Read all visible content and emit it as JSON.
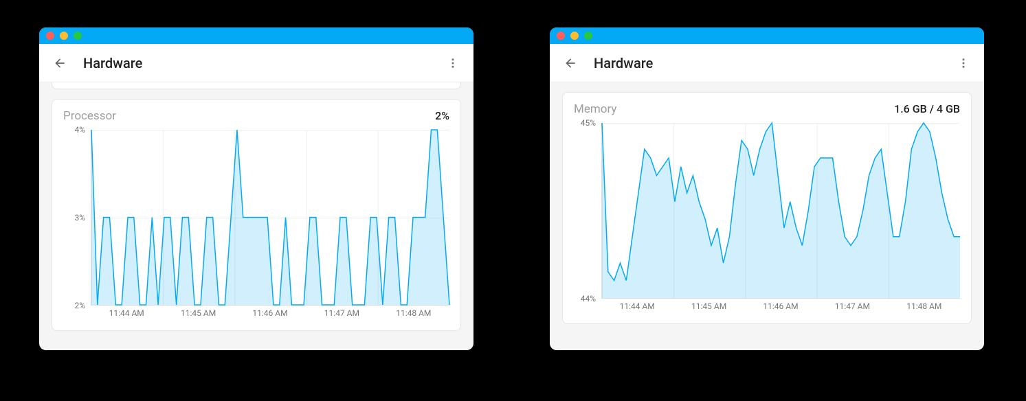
{
  "windows": [
    {
      "id": "processor",
      "title": "Hardware",
      "card": {
        "title": "Processor",
        "value": "2%"
      },
      "peek_above": true
    },
    {
      "id": "memory",
      "title": "Hardware",
      "card": {
        "title": "Memory",
        "value": "1.6 GB / 4 GB"
      },
      "peek_above": false
    }
  ],
  "chart_data": [
    {
      "type": "area",
      "title": "Processor",
      "ylabel": "%",
      "ylim": [
        2,
        4
      ],
      "y_ticks": [
        "4%",
        "3%",
        "2%"
      ],
      "x_ticks": [
        "11:44 AM",
        "11:45 AM",
        "11:46 AM",
        "11:47 AM",
        "11:48 AM"
      ],
      "x": [
        0,
        1,
        2,
        3,
        4,
        5,
        6,
        7,
        8,
        9,
        10,
        11,
        12,
        13,
        14,
        15,
        16,
        17,
        18,
        19,
        20,
        21,
        22,
        23,
        24,
        25,
        26,
        27,
        28,
        29,
        30,
        31,
        32,
        33,
        34,
        35,
        36,
        37,
        38,
        39,
        40,
        41,
        42,
        43,
        44,
        45,
        46,
        47,
        48,
        49,
        50,
        51,
        52,
        53,
        54,
        55,
        56,
        57,
        58,
        59
      ],
      "values": [
        4,
        2,
        3,
        3,
        2,
        2,
        3,
        3,
        2,
        2,
        3,
        2,
        3,
        3,
        2,
        3,
        3,
        2,
        2,
        3,
        3,
        2,
        2,
        3,
        4,
        3,
        3,
        3,
        3,
        3,
        2,
        2,
        3,
        2,
        2,
        2,
        3,
        3,
        2,
        2,
        2,
        3,
        3,
        2,
        2,
        2,
        3,
        3,
        2,
        3,
        3,
        2,
        2,
        3,
        3,
        3,
        4,
        4,
        3,
        2
      ]
    },
    {
      "type": "area",
      "title": "Memory",
      "ylabel": "%",
      "ylim": [
        44,
        45
      ],
      "y_ticks": [
        "45%",
        "44%"
      ],
      "x_ticks": [
        "11:44 AM",
        "11:45 AM",
        "11:46 AM",
        "11:47 AM",
        "11:48 AM"
      ],
      "x": [
        0,
        1,
        2,
        3,
        4,
        5,
        6,
        7,
        8,
        9,
        10,
        11,
        12,
        13,
        14,
        15,
        16,
        17,
        18,
        19,
        20,
        21,
        22,
        23,
        24,
        25,
        26,
        27,
        28,
        29,
        30,
        31,
        32,
        33,
        34,
        35,
        36,
        37,
        38,
        39,
        40,
        41,
        42,
        43,
        44,
        45,
        46,
        47,
        48,
        49,
        50,
        51,
        52,
        53,
        54,
        55,
        56,
        57,
        58,
        59
      ],
      "values": [
        45.0,
        44.15,
        44.1,
        44.2,
        44.1,
        44.35,
        44.6,
        44.85,
        44.8,
        44.7,
        44.75,
        44.8,
        44.55,
        44.75,
        44.6,
        44.7,
        44.55,
        44.45,
        44.3,
        44.4,
        44.2,
        44.35,
        44.65,
        44.9,
        44.85,
        44.7,
        44.85,
        44.95,
        45.0,
        44.7,
        44.4,
        44.55,
        44.4,
        44.3,
        44.5,
        44.75,
        44.8,
        44.8,
        44.8,
        44.55,
        44.35,
        44.3,
        44.35,
        44.5,
        44.7,
        44.8,
        44.85,
        44.6,
        44.35,
        44.35,
        44.55,
        44.85,
        44.95,
        45.0,
        44.95,
        44.8,
        44.6,
        44.45,
        44.35,
        44.35
      ]
    }
  ]
}
